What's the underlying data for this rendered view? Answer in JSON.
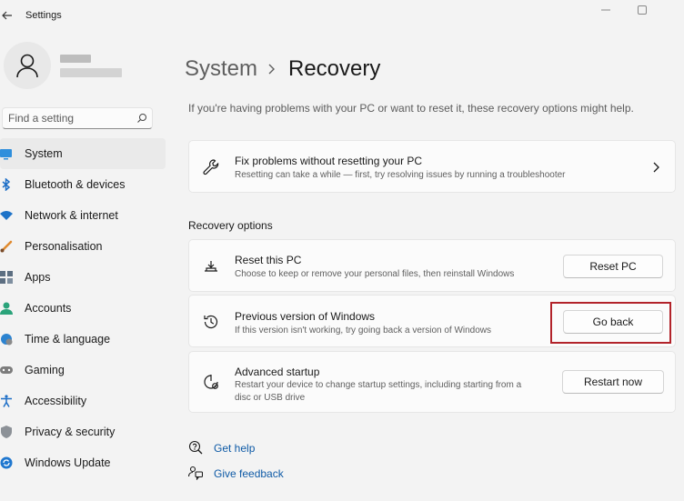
{
  "window": {
    "title": "Settings"
  },
  "search": {
    "placeholder": "Find a setting"
  },
  "sidebar": {
    "items": [
      {
        "label": "System",
        "icon": "system-icon",
        "active": true
      },
      {
        "label": "Bluetooth & devices",
        "icon": "bluetooth-icon"
      },
      {
        "label": "Network & internet",
        "icon": "wifi-icon"
      },
      {
        "label": "Personalisation",
        "icon": "brush-icon"
      },
      {
        "label": "Apps",
        "icon": "apps-icon"
      },
      {
        "label": "Accounts",
        "icon": "accounts-icon"
      },
      {
        "label": "Time & language",
        "icon": "globe-clock-icon"
      },
      {
        "label": "Gaming",
        "icon": "gamepad-icon"
      },
      {
        "label": "Accessibility",
        "icon": "accessibility-icon"
      },
      {
        "label": "Privacy & security",
        "icon": "shield-icon"
      },
      {
        "label": "Windows Update",
        "icon": "update-icon"
      }
    ]
  },
  "breadcrumb": {
    "parent": "System",
    "current": "Recovery"
  },
  "intro": "If you're having problems with your PC or want to reset it, these recovery options might help.",
  "fix_card": {
    "title": "Fix problems without resetting your PC",
    "subtitle": "Resetting can take a while — first, try resolving issues by running a troubleshooter"
  },
  "recovery_options": {
    "heading": "Recovery options",
    "reset": {
      "title": "Reset this PC",
      "subtitle": "Choose to keep or remove your personal files, then reinstall Windows",
      "button": "Reset PC"
    },
    "previous": {
      "title": "Previous version of Windows",
      "subtitle": "If this version isn't working, try going back a version of Windows",
      "button": "Go back"
    },
    "advanced": {
      "title": "Advanced startup",
      "subtitle_line1": "Restart your device to change startup settings, including starting from a",
      "subtitle_line2": "disc or USB drive",
      "button": "Restart now"
    }
  },
  "links": {
    "help": "Get help",
    "feedback": "Give feedback"
  },
  "colors": {
    "accent": "#0067c0",
    "highlight_box": "#b2232a",
    "link": "#0e5aa6"
  }
}
